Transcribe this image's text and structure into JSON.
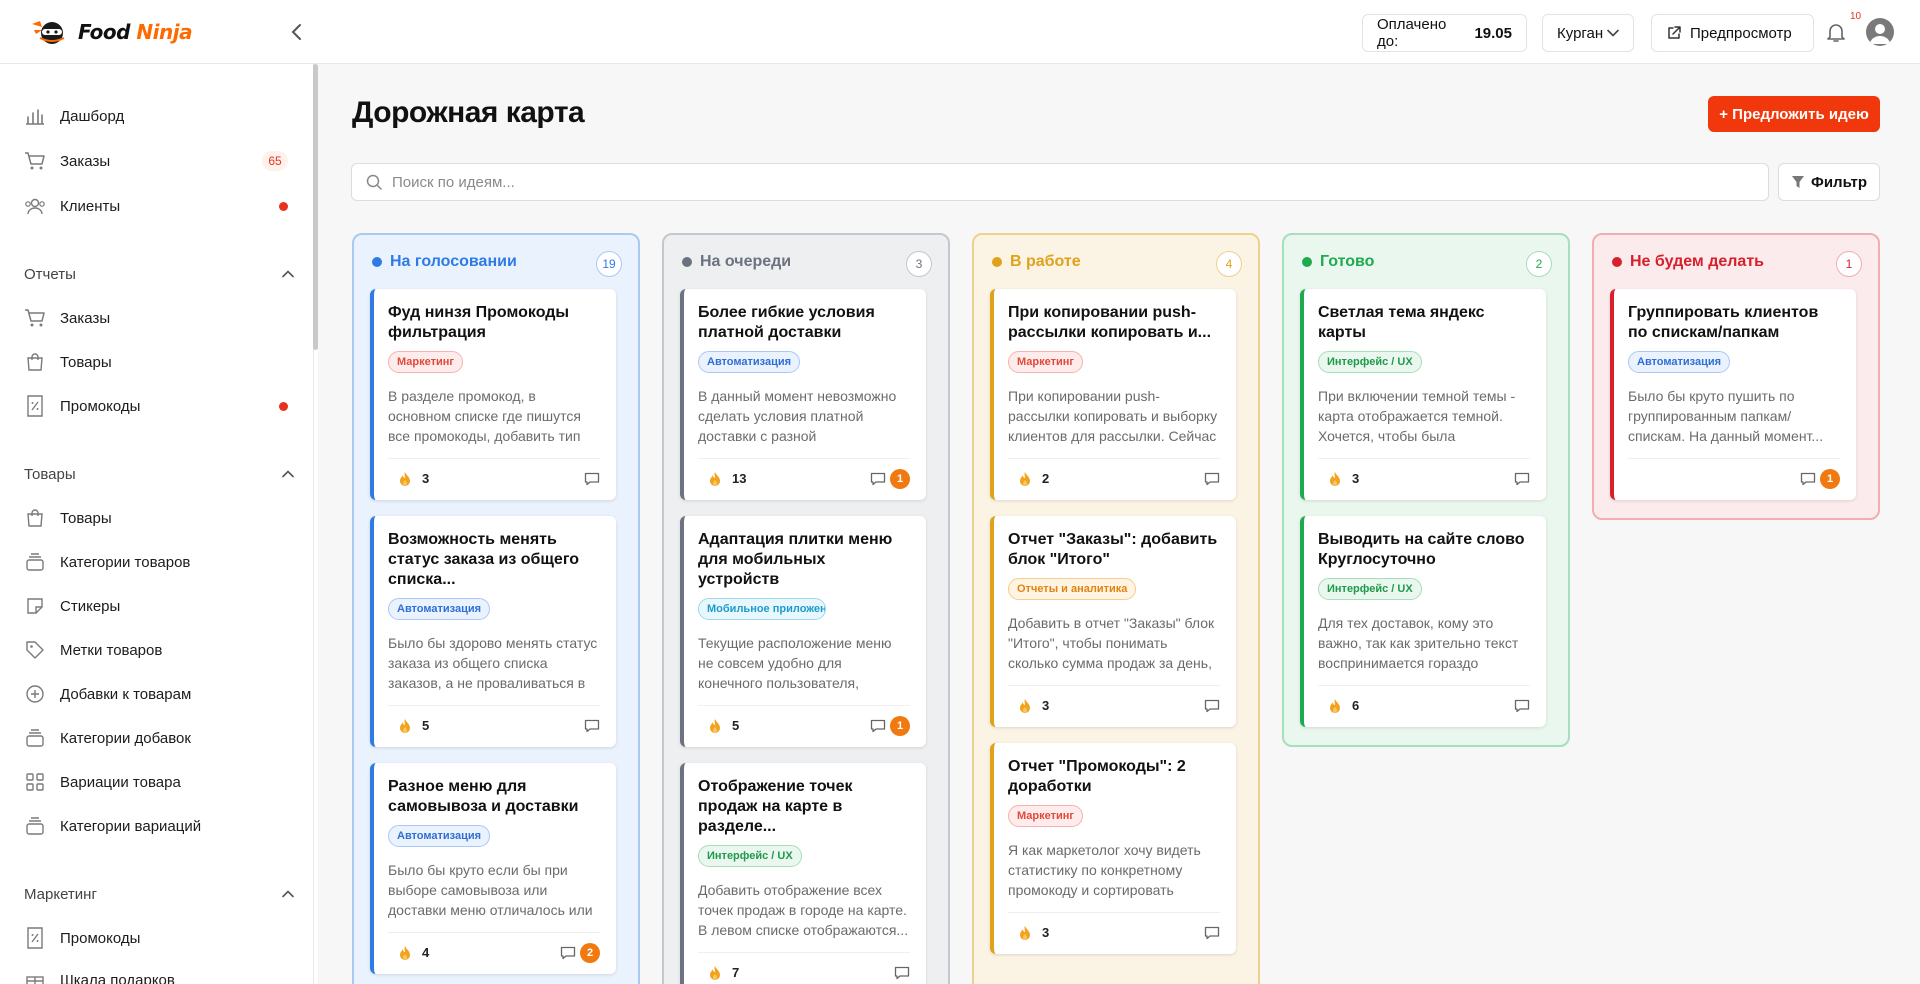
{
  "header": {
    "logo_word1": "Food",
    "logo_word2": "Ninja",
    "paid_label": "Оплачено до:",
    "paid_date": "19.05",
    "city": "Курган",
    "preview_label": "Предпросмотр",
    "notifications_count": "10"
  },
  "sidebar": {
    "top_items": [
      {
        "label": "Дашборд",
        "icon": "chart-icon"
      },
      {
        "label": "Заказы",
        "icon": "cart-icon",
        "badge": "65"
      },
      {
        "label": "Клиенты",
        "icon": "users-icon",
        "dot": true
      }
    ],
    "reports_title": "Отчеты",
    "reports": [
      {
        "label": "Заказы",
        "icon": "cart-icon"
      },
      {
        "label": "Товары",
        "icon": "bag-icon"
      },
      {
        "label": "Промокоды",
        "icon": "percent-icon",
        "dot": true
      }
    ],
    "goods_title": "Товары",
    "goods": [
      {
        "label": "Товары",
        "icon": "bag-icon"
      },
      {
        "label": "Категории товаров",
        "icon": "stack-icon"
      },
      {
        "label": "Стикеры",
        "icon": "sticker-icon"
      },
      {
        "label": "Метки товаров",
        "icon": "tag-icon"
      },
      {
        "label": "Добавки к товарам",
        "icon": "plus-circle-icon"
      },
      {
        "label": "Категории добавок",
        "icon": "stack-icon"
      },
      {
        "label": "Вариации товара",
        "icon": "grid-icon"
      },
      {
        "label": "Категории вариаций",
        "icon": "stack-icon"
      }
    ],
    "marketing_title": "Маркетинг",
    "marketing": [
      {
        "label": "Промокоды",
        "icon": "percent-icon"
      },
      {
        "label": "Шкала подарков",
        "icon": "gift-icon"
      }
    ]
  },
  "main": {
    "title": "Дорожная карта",
    "suggest_label": "+ Предложить идею",
    "search_placeholder": "Поиск по идеям...",
    "filter_label": "Фильтр"
  },
  "colors": {
    "accent": "#f0380c",
    "blue": "#2f7be5",
    "gray": "#6b7280",
    "amber": "#e0a21a",
    "green": "#1faa4f",
    "red": "#d6202c"
  },
  "columns": [
    {
      "title": "На голосовании",
      "count": "19",
      "color": "#2f7be5",
      "bg": "#eaf2fe",
      "border": "#a9c9f4",
      "cards": [
        {
          "title": "Фуд нинзя Промокоды фильтрация",
          "tag": "Маркетинг",
          "tag_kind": "red",
          "desc": "В разделе промокод, в основном списке где пишутся все промокоды, добавить тип этого...",
          "votes": "3",
          "comments": ""
        },
        {
          "title": "Возможность менять статус заказа из общего списка...",
          "tag": "Автоматизация",
          "tag_kind": "blue",
          "desc": "Было бы здорово менять статус заказа из общего списка заказов, а не проваливаться в каждый...",
          "votes": "5",
          "comments": ""
        },
        {
          "title": "Разное меню для самовывоза и доставки",
          "tag": "Автоматизация",
          "tag_kind": "blue",
          "desc": "Было бы круто если бы при выборе самовывоза или доставки меню отличалось или его можн...",
          "votes": "4",
          "comments": "2"
        }
      ]
    },
    {
      "title": "На очереди",
      "count": "3",
      "color": "#6b7280",
      "bg": "#eeeff1",
      "border": "#c4c7cc",
      "cards": [
        {
          "title": "Более гибкие условия платной доставки",
          "tag": "Автоматизация",
          "tag_kind": "blue",
          "desc": "В данный момент невозможно сделать условия платной доставки с разной минимальной...",
          "votes": "13",
          "comments": "1"
        },
        {
          "title": "Адаптация плитки меню для мобильных устройств",
          "tag": "Мобильное приложение",
          "tag_kind": "cyan",
          "desc": "Текущие расположение меню не совсем удобно для конечного пользователя, предлагаем...",
          "votes": "5",
          "comments": "1"
        },
        {
          "title": "Отображение точек продаж на карте в разделе...",
          "tag": "Интерфейс / UX",
          "tag_kind": "green",
          "desc": "Добавить отображение всех точек продаж в городе на карте. В левом списке отображаются...",
          "votes": "7",
          "comments": ""
        }
      ]
    },
    {
      "title": "В работе",
      "count": "4",
      "color": "#e0a21a",
      "bg": "#fbf3e4",
      "border": "#efd18f",
      "cards": [
        {
          "title": "При копировании push-рассылки копировать и...",
          "tag": "Маркетинг",
          "tag_kind": "red",
          "desc": "При копировании push-рассылки копировать и выборку клиентов для рассылки. Сейчас при...",
          "votes": "2",
          "comments": ""
        },
        {
          "title": "Отчет \"Заказы\": добавить блок \"Итого\"",
          "tag": "Отчеты и аналитика",
          "tag_kind": "orange",
          "desc": "Добавить в отчет \"Заказы\" блок \"Итого\", чтобы понимать сколько сумма продаж за день, неделю ...",
          "votes": "3",
          "comments": ""
        },
        {
          "title": "Отчет \"Промокоды\": 2 доработки",
          "tag": "Маркетинг",
          "tag_kind": "red",
          "desc": "Я как маркетолог хочу видеть статистику по конкретному промокоду и сортировать отчет...",
          "votes": "3",
          "comments": ""
        }
      ]
    },
    {
      "title": "Готово",
      "count": "2",
      "color": "#1faa4f",
      "bg": "#e9f7ee",
      "border": "#a6dfb9",
      "cards": [
        {
          "title": "Светлая тема яндекс карты",
          "tag": "Интерфейс / UX",
          "tag_kind": "green",
          "desc": "При включении темной темы - карта отображается темной. Хочется, чтобы была включена...",
          "votes": "3",
          "comments": ""
        },
        {
          "title": "Выводить на сайте слово Круглосуточно",
          "tag": "Интерфейс / UX",
          "tag_kind": "green",
          "desc": "Для тех доставок, кому это важно, так как зрительно текст воспринимается гораздо точнее...",
          "votes": "6",
          "comments": ""
        }
      ]
    },
    {
      "title": "Не будем делать",
      "count": "1",
      "color": "#d6202c",
      "bg": "#fcebec",
      "border": "#f1aeb2",
      "cards": [
        {
          "title": "Группировать клиентов по спискам/папкам",
          "tag": "Автоматизация",
          "tag_kind": "blue",
          "desc": "Было бы круто пушить по группированным папкам/ спискам. На данный момент...",
          "votes": "",
          "comments": "1"
        }
      ]
    }
  ]
}
